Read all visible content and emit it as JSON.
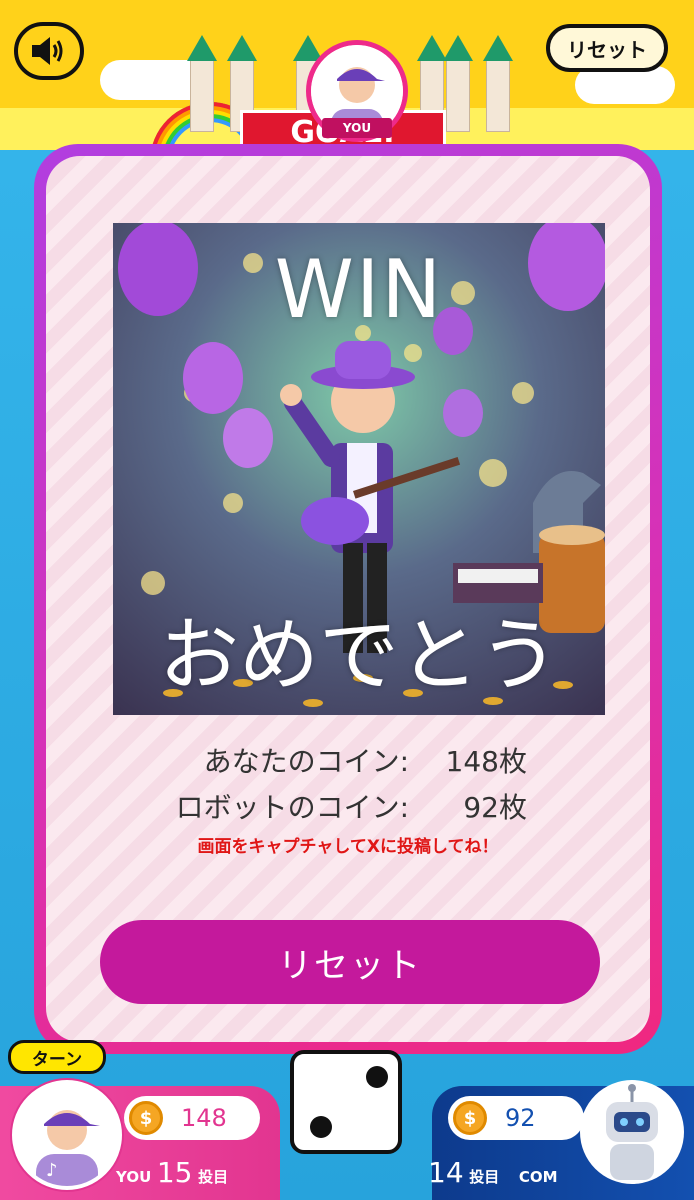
{
  "header": {
    "sound_icon": "speaker-on-icon",
    "reset_label": "リセット",
    "player_tag": "YOU",
    "goal_banner": "GOAL!"
  },
  "modal": {
    "hero_title": "WIN",
    "hero_subtitle": "おめでとう",
    "your_coins_label": "あなたのコイン:",
    "your_coins_value": "148枚",
    "robot_coins_label": "ロボットのコイン:",
    "robot_coins_value": "92枚",
    "share_note": "画面をキャプチャしてXに投稿してね！",
    "reset_button": "リセット"
  },
  "hud": {
    "turn_label": "ターン",
    "you": {
      "coins": "148",
      "name": "YOU",
      "throws": "15",
      "throws_suffix": "投目"
    },
    "com": {
      "coins": "92",
      "name": "COM",
      "throws": "14",
      "throws_suffix": "投目"
    },
    "dice_value": 2,
    "coin_symbol": "$"
  },
  "colors": {
    "accent_pink": "#e23590",
    "accent_purple": "#c4199c",
    "com_blue": "#1350b0",
    "note_red": "#e01616"
  }
}
